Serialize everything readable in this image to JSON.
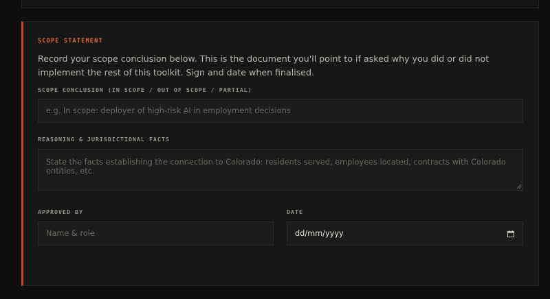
{
  "section": {
    "eyebrow": "SCOPE STATEMENT",
    "intro": "Record your scope conclusion below. This is the document you'll point to if asked why you did or did not implement the rest of this toolkit. Sign and date when finalised."
  },
  "fields": {
    "conclusion": {
      "label": "SCOPE CONCLUSION (IN SCOPE / OUT OF SCOPE / PARTIAL)",
      "placeholder": "e.g. In scope: deployer of high-risk AI in employment decisions"
    },
    "reasoning": {
      "label": "REASONING & JURISDICTIONAL FACTS",
      "placeholder": "State the facts establishing the connection to Colorado: residents served, employees located, contracts with Colorado entities, etc."
    },
    "approved_by": {
      "label": "APPROVED BY",
      "placeholder": "Name & role"
    },
    "date": {
      "label": "DATE",
      "value": "dd/mm/yyyy",
      "icon": "calendar-icon"
    }
  },
  "colors": {
    "accent": "#c4491a",
    "eyebrow": "#d9703c",
    "background": "#0e0e0e",
    "card": "#171717"
  }
}
